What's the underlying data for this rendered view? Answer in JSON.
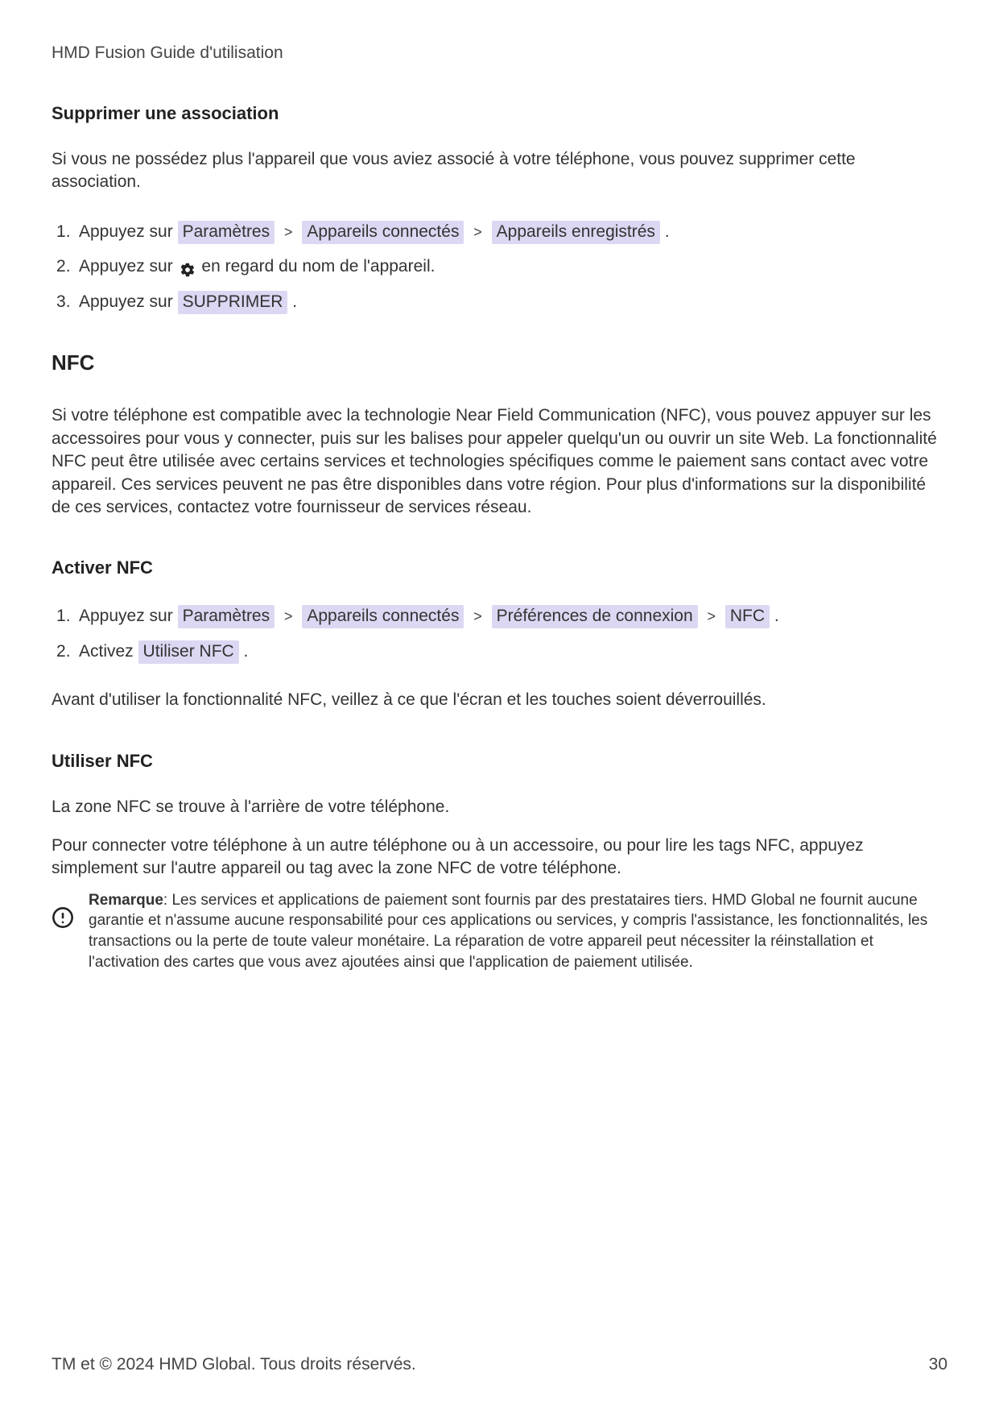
{
  "header": {
    "doc_title": "HMD Fusion Guide d'utilisation"
  },
  "section_delete": {
    "heading": "Supprimer une association",
    "intro": "Si vous ne possédez plus l'appareil que vous aviez associé à votre téléphone, vous pouvez supprimer cette association.",
    "steps": {
      "s1_pre": "Appuyez sur ",
      "s1_chip1": "Paramètres",
      "s1_chip2": "Appareils connectés",
      "s1_chip3": "Appareils enregistrés",
      "s1_post": ".",
      "s2_pre": "Appuyez sur ",
      "s2_post": " en regard du nom de l'appareil.",
      "s3_pre": "Appuyez sur ",
      "s3_chip": "SUPPRIMER",
      "s3_post": "."
    }
  },
  "section_nfc": {
    "title": "NFC",
    "intro": "Si votre téléphone est compatible avec la technologie Near Field Communication (NFC), vous pouvez appuyer sur les accessoires pour vous y connecter, puis sur les balises pour appeler quelqu'un ou ouvrir un site Web. La fonctionnalité NFC peut être utilisée avec certains services et technologies spécifiques comme le paiement sans contact avec votre appareil. Ces services peuvent ne pas être disponibles dans votre région. Pour plus d'informations sur la disponibilité de ces services, contactez votre fournisseur de services réseau.",
    "activate_heading": "Activer NFC",
    "activate_steps": {
      "s1_pre": "Appuyez sur ",
      "s1_chip1": "Paramètres",
      "s1_chip2": "Appareils connectés",
      "s1_chip3": "Préférences de connexion",
      "s1_chip4": "NFC",
      "s1_post": ".",
      "s2_pre": "Activez ",
      "s2_chip": "Utiliser NFC",
      "s2_post": "."
    },
    "activate_note": "Avant d'utiliser la fonctionnalité NFC, veillez à ce que l'écran et les touches soient déverrouillés.",
    "use_heading": "Utiliser NFC",
    "use_p1": "La zone NFC se trouve à l'arrière de votre téléphone.",
    "use_p2": "Pour connecter votre téléphone à un autre téléphone ou à un accessoire, ou pour lire les tags NFC, appuyez simplement sur l'autre appareil ou tag avec la zone NFC de votre téléphone.",
    "note_label": "Remarque",
    "note_body": ": Les services et applications de paiement sont fournis par des prestataires tiers. HMD Global ne fournit aucune garantie et n'assume aucune responsabilité pour ces applications ou services, y compris l'assistance, les fonctionnalités, les transactions ou la perte de toute valeur monétaire. La réparation de votre appareil peut nécessiter la réinstallation et l'activation des cartes que vous avez ajoutées ainsi que l'application de paiement utilisée."
  },
  "chevron": ">",
  "footer": {
    "copyright": "TM et © 2024 HMD Global. Tous droits réservés.",
    "page": "30"
  }
}
